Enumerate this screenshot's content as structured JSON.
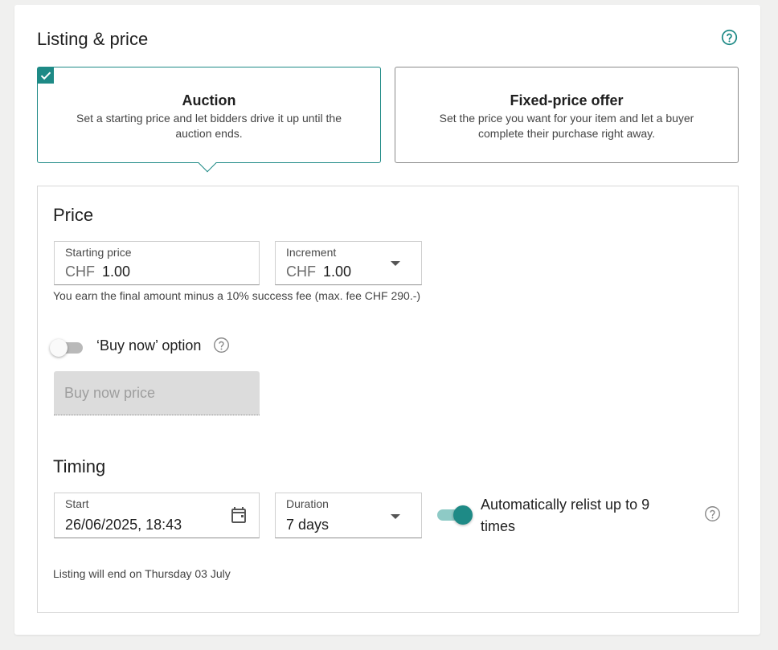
{
  "card": {
    "title": "Listing & price"
  },
  "listing_types": {
    "auction": {
      "title": "Auction",
      "description": "Set a starting price and let bidders drive it up until the auction ends.",
      "selected": true
    },
    "fixed": {
      "title": "Fixed-price offer",
      "description": "Set the price you want for your item and let a buyer complete their purchase right away.",
      "selected": false
    }
  },
  "price": {
    "section_title": "Price",
    "starting_price": {
      "label": "Starting price",
      "currency": "CHF",
      "value": "1.00"
    },
    "increment": {
      "label": "Increment",
      "currency": "CHF",
      "value": "1.00"
    },
    "fee_note": "You earn the final amount minus a 10% success fee (max. fee CHF 290.-)",
    "buy_now": {
      "label": "‘Buy now’ option",
      "enabled": false,
      "placeholder": "Buy now price"
    }
  },
  "timing": {
    "section_title": "Timing",
    "start": {
      "label": "Start",
      "value": "26/06/2025, 18:43"
    },
    "duration": {
      "label": "Duration",
      "value": "7 days"
    },
    "relist": {
      "label": "Automatically relist up to 9 times",
      "enabled": true
    },
    "end_note": "Listing will end on Thursday 03 July"
  },
  "colors": {
    "accent": "#1e8a86",
    "accent_light": "#8ecac6",
    "page_bg": "#f0f0ef",
    "disabled_field": "#dcdcdc"
  },
  "icons": {
    "help": "help-circle-icon",
    "check": "check-icon",
    "calendar": "calendar-icon",
    "dropdown": "caret-down-icon"
  }
}
